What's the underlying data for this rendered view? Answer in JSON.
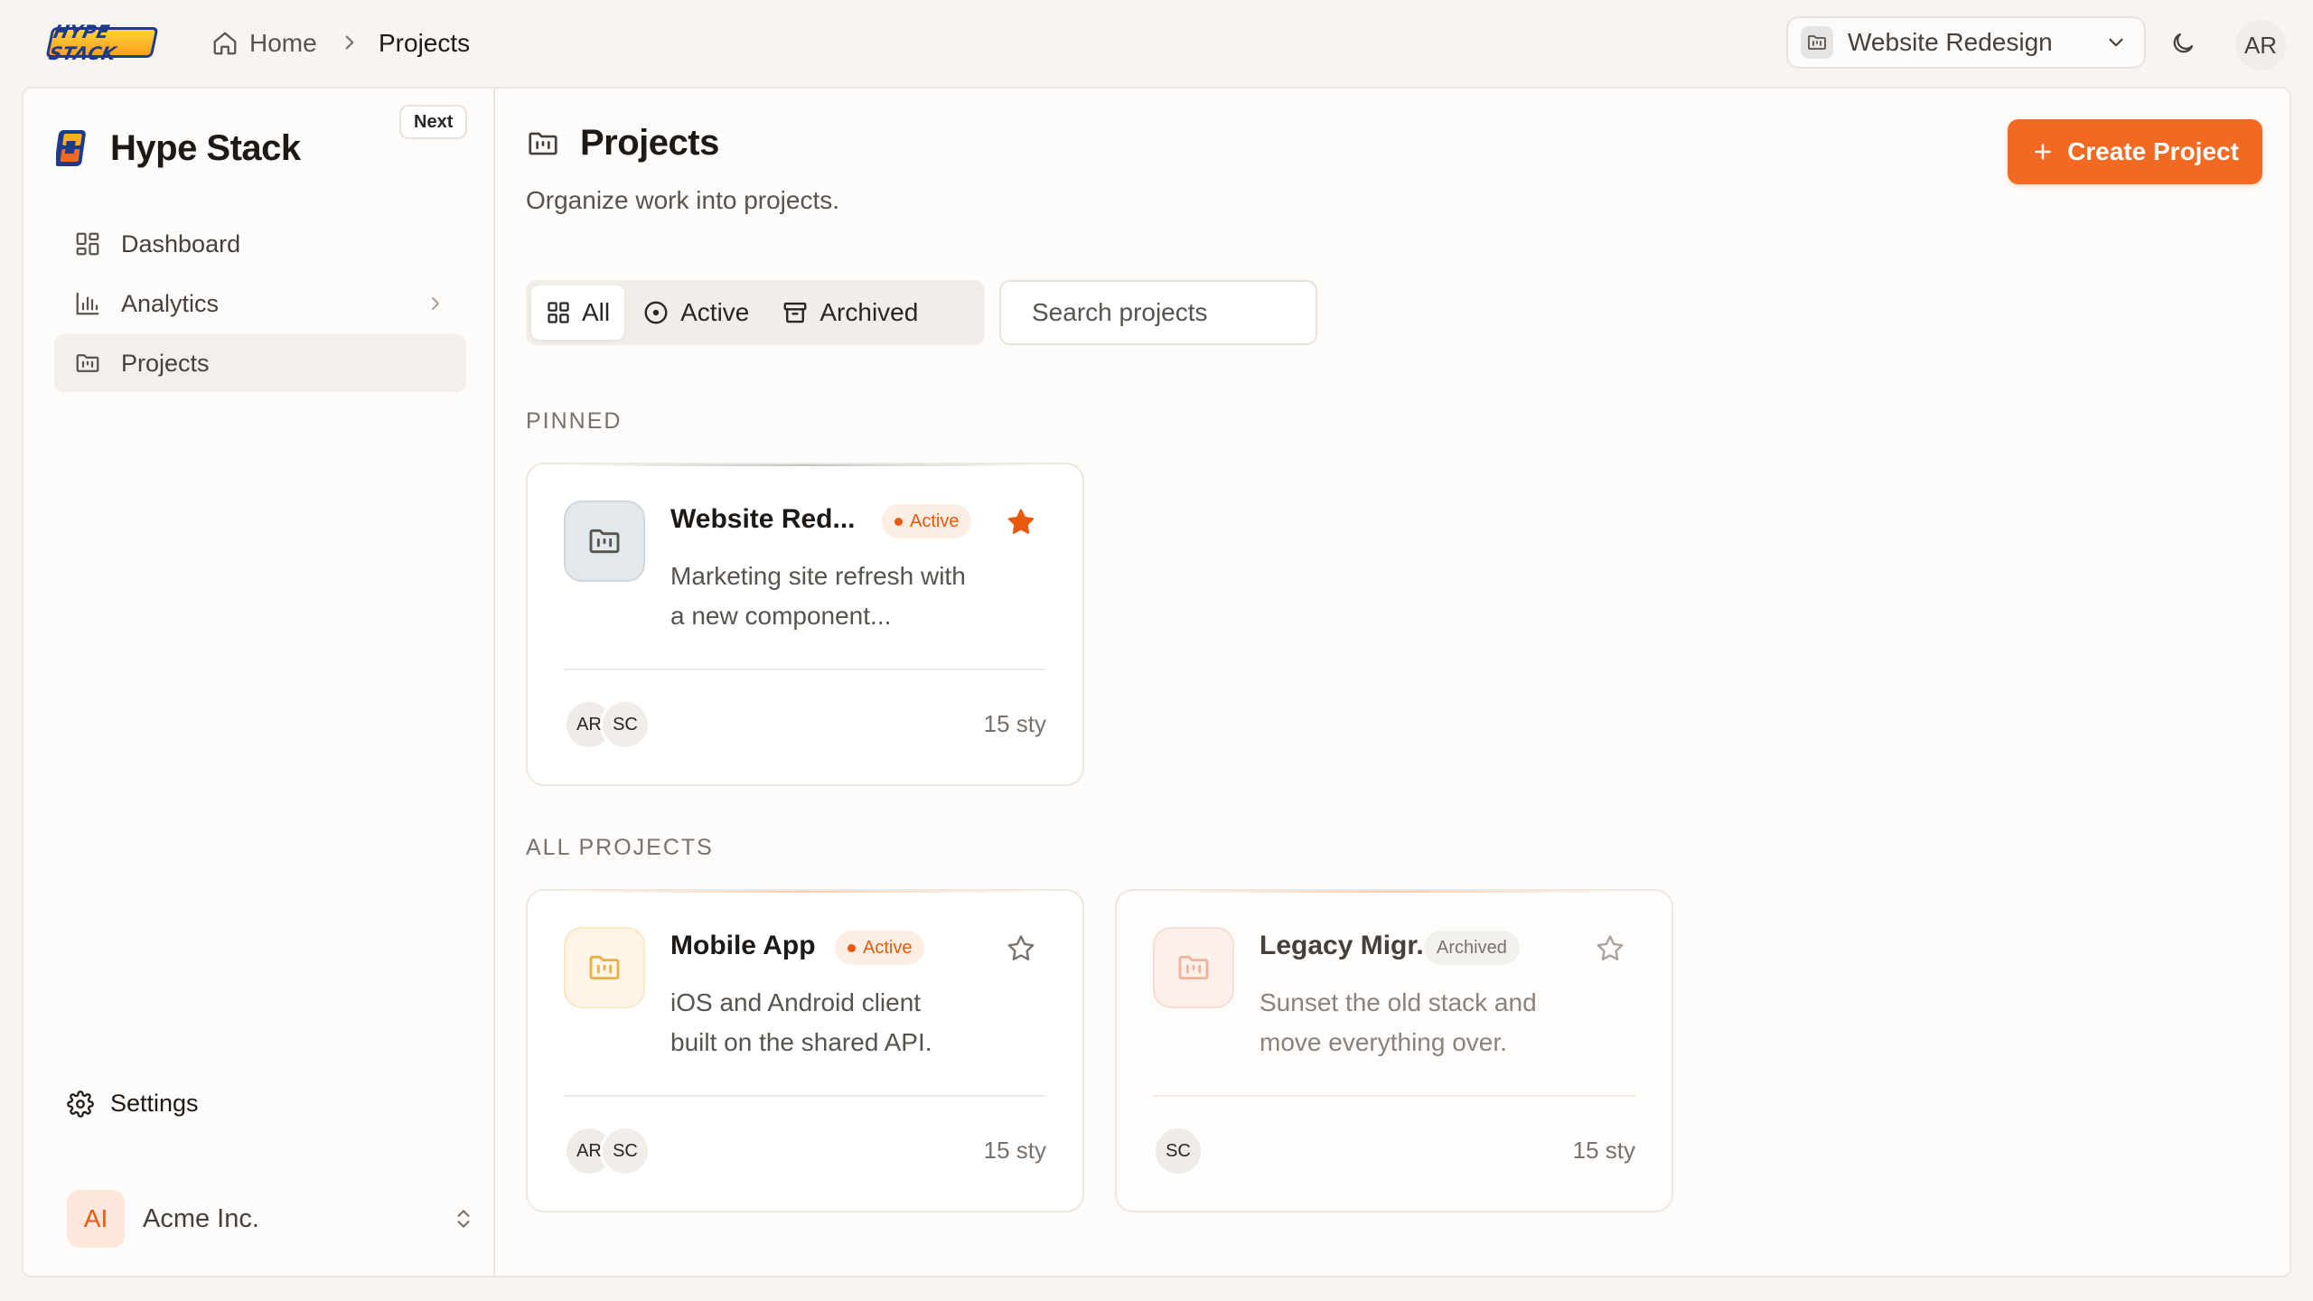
{
  "topbar": {
    "logo_text": "HYPE STACK",
    "breadcrumb": {
      "home": "Home",
      "current": "Projects"
    },
    "project_switcher": {
      "label": "Website Redesign"
    },
    "user_initials": "AR"
  },
  "sidebar": {
    "brand": "Hype Stack",
    "badge": "Next",
    "items": [
      {
        "label": "Dashboard",
        "icon": "dashboard-icon"
      },
      {
        "label": "Analytics",
        "icon": "analytics-icon"
      },
      {
        "label": "Projects",
        "icon": "projects-icon"
      }
    ],
    "settings": "Settings",
    "org": {
      "initials": "AI",
      "name": "Acme Inc."
    }
  },
  "main": {
    "title": "Projects",
    "subtitle": "Organize work into projects.",
    "create_button": "Create Project",
    "filters": [
      {
        "label": "All",
        "selected": true
      },
      {
        "label": "Active",
        "selected": false
      },
      {
        "label": "Archived",
        "selected": false
      }
    ],
    "search": {
      "placeholder": "Search projects",
      "value": ""
    },
    "sections": {
      "pinned": "PINNED",
      "all": "ALL PROJECTS"
    },
    "pinned": [
      {
        "title": "Website Red...",
        "status": "Active",
        "starred": true,
        "description": "Marketing site refresh with a new component...",
        "avatars": [
          "AR",
          "SC"
        ],
        "count": "15 sty"
      }
    ],
    "projects": [
      {
        "title": "Mobile App",
        "status": "Active",
        "starred": false,
        "description": "iOS and Android client built on the shared API.",
        "avatars": [
          "AR",
          "SC"
        ],
        "count": "15 sty"
      },
      {
        "title": "Legacy Migr...",
        "status": "Archived",
        "starred": false,
        "description": "Sunset the old stack and move everything over.",
        "avatars": [
          "SC"
        ],
        "count": "15 sty"
      }
    ]
  },
  "colors": {
    "accent": "#f26a21",
    "background": "#f8f5f1",
    "active_badge": "#ea580c"
  }
}
